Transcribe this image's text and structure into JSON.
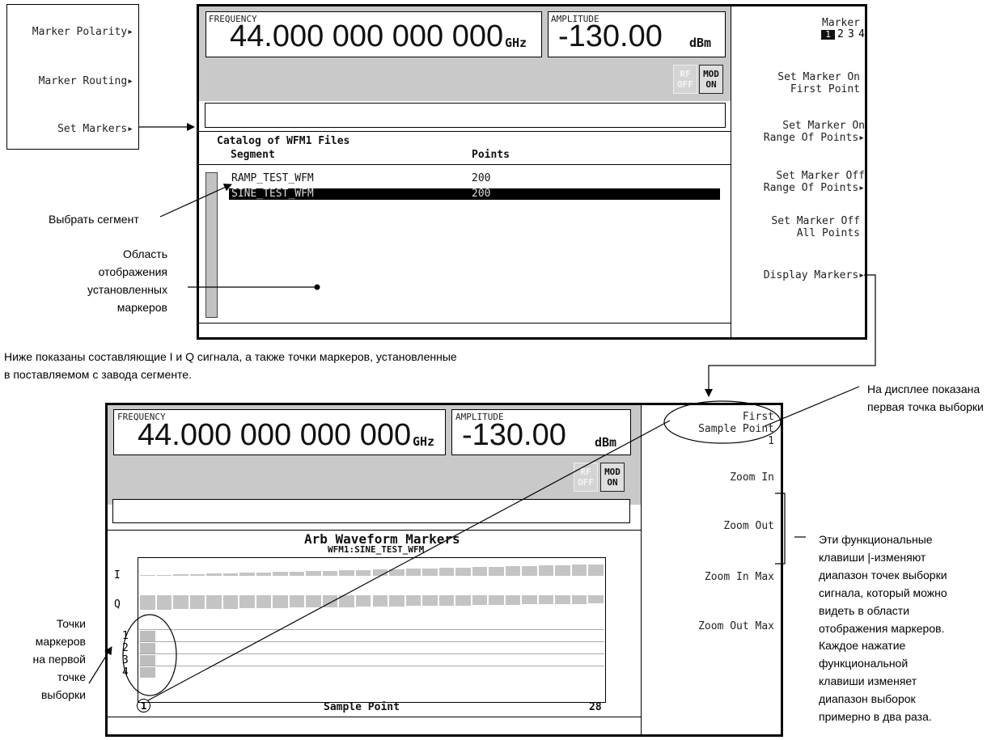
{
  "screen1": {
    "frequency_label": "FREQUENCY",
    "frequency_value": "44.000 000 000 000",
    "frequency_unit": "GHz",
    "amplitude_label": "AMPLITUDE",
    "amplitude_value": "-130.00",
    "amplitude_unit": "dBm",
    "rf_status": "RF OFF",
    "mod_status": "MOD ON",
    "catalog_title": "Catalog of WFM1 Files",
    "col_segment": "Segment",
    "col_points": "Points",
    "rows": [
      {
        "segment": "RAMP_TEST_WFM",
        "points": "200",
        "selected": false
      },
      {
        "segment": "SINE_TEST_WFM",
        "points": "200",
        "selected": true
      }
    ],
    "softkeys": {
      "marker_title": "Marker",
      "marker_numbers": [
        "1",
        "2",
        "3",
        "4"
      ],
      "set_on_first": "Set Marker On\nFirst Point",
      "set_on_range": "Set Marker On\nRange Of Points",
      "set_off_range": "Set Marker Off\nRange Of Points",
      "set_off_all": "Set Marker Off\nAll Points",
      "display_markers": "Display Markers"
    }
  },
  "menu": {
    "marker_polarity": "Marker Polarity",
    "marker_routing": "Marker Routing",
    "set_markers": "Set Markers"
  },
  "annotations": {
    "select_segment": "Выбрать сегмент",
    "display_area": "Область\nотображения\nустановленных\nмаркеров",
    "middle_text": "Ниже показаны составляющие I и Q сигнала, а также точки маркеров, установленные\nв поставляемом с завода сегменте.",
    "first_point_note": "На дисплее показана\nпервая точка выборки",
    "zoom_note": "Эти функциональные\nклавиши |-изменяют\nдиапазон точек выборки\nсигнала, который можно\nвидеть в области\nотображения маркеров.",
    "each_press_note": "Каждое нажатие\nфункциональной\nклавиши изменяет\nдиапазон выборок\nпримерно в два раза.",
    "marker_points_note": "Точки\nмаркеров\nна первой\nточке\nвыборки"
  },
  "screen2": {
    "frequency_label": "FREQUENCY",
    "frequency_value": "44.000 000 000 000",
    "frequency_unit": "GHz",
    "amplitude_label": "AMPLITUDE",
    "amplitude_value": "-130.00",
    "amplitude_unit": "dBm",
    "rf_status": "RF OFF",
    "mod_status": "MOD ON",
    "graph_title": "Arb Waveform Markers",
    "graph_subtitle": "WFM1:SINE_TEST_WFM",
    "row_labels": [
      "I",
      "Q",
      "1",
      "2",
      "3",
      "4"
    ],
    "x_start": "1",
    "x_label": "Sample Point",
    "x_end": "28",
    "softkeys": {
      "first_sample": "First\nSample Point\n1",
      "zoom_in": "Zoom In",
      "zoom_out": "Zoom Out",
      "zoom_in_max": "Zoom In Max",
      "zoom_out_max": "Zoom Out Max"
    }
  }
}
